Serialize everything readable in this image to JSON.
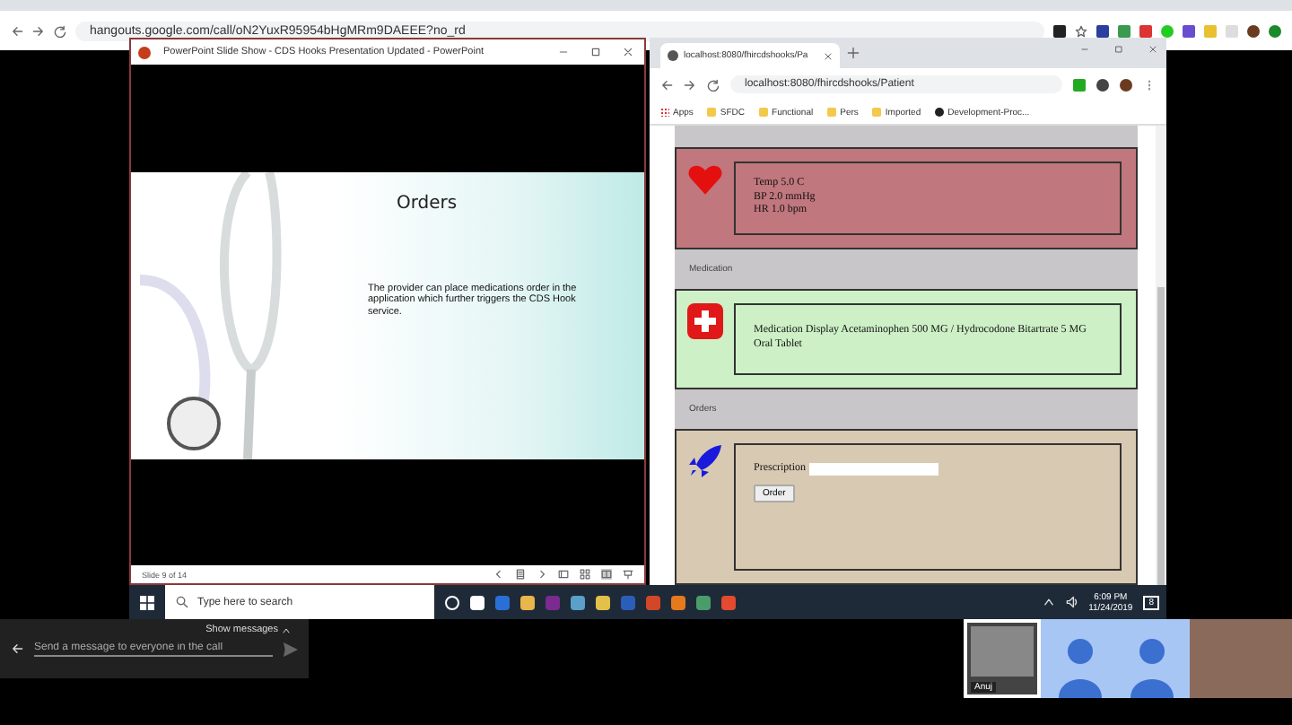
{
  "browser": {
    "url": "hangouts.google.com/call/oN2YuxR95954bHgMRm9DAEEE?no_rd"
  },
  "powerpoint": {
    "title": "PowerPoint Slide Show  -  CDS Hooks Presentation Updated - PowerPoint",
    "slide_title": "Orders",
    "slide_body": "The provider can place medications order in the application which further triggers the CDS Hook service.",
    "status": "Slide 9 of 14"
  },
  "chrome": {
    "tab": "localhost:8080/fhircdshooks/Pa",
    "address": "localhost:8080/fhircdshooks/Patient",
    "bookmarks": [
      {
        "kind": "apps",
        "label": "Apps"
      },
      {
        "kind": "folder",
        "label": "SFDC"
      },
      {
        "kind": "folder",
        "label": "Functional"
      },
      {
        "kind": "folder",
        "label": "Pers"
      },
      {
        "kind": "folder",
        "label": "Imported"
      },
      {
        "kind": "github",
        "label": "Development-Proc..."
      }
    ],
    "sections": [
      {
        "kind": "vitals",
        "lines": [
          "Temp 5.0 C",
          "BP 2.0 mmHg",
          "HR 1.0 bpm"
        ]
      },
      {
        "kind": "header",
        "label": "Medication"
      },
      {
        "kind": "medication",
        "text": "Medication Display Acetaminophen 500 MG / Hydrocodone Bitartrate 5 MG Oral Tablet"
      },
      {
        "kind": "header",
        "label": "Orders"
      },
      {
        "kind": "order",
        "label": "Prescription",
        "button": "Order"
      }
    ]
  },
  "taskbar": {
    "search": "Type here to search",
    "time": "6:09 PM",
    "date": "11/24/2019",
    "notifications": "8"
  },
  "chat": {
    "toggle": "Show messages",
    "placeholder": "Send a message to everyone in the call"
  },
  "participants": [
    {
      "kind": "screen",
      "name": "Anuj"
    },
    {
      "kind": "avatars"
    },
    {
      "kind": "photo"
    }
  ]
}
